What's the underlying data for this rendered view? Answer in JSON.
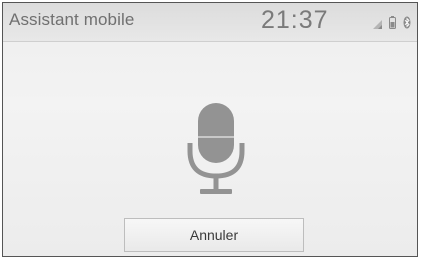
{
  "header": {
    "title": "Assistant mobile",
    "clock": "21:37",
    "status_icons": [
      "signal-icon",
      "battery-icon",
      "bluetooth-icon"
    ]
  },
  "main": {
    "center_icon": "microphone-icon"
  },
  "footer": {
    "cancel_label": "Annuler"
  },
  "colors": {
    "background": "#EEEEEE",
    "header_background": "#E0E0E0",
    "text": "#707070",
    "icon": "#909090",
    "button_border": "#BDBDBD"
  }
}
